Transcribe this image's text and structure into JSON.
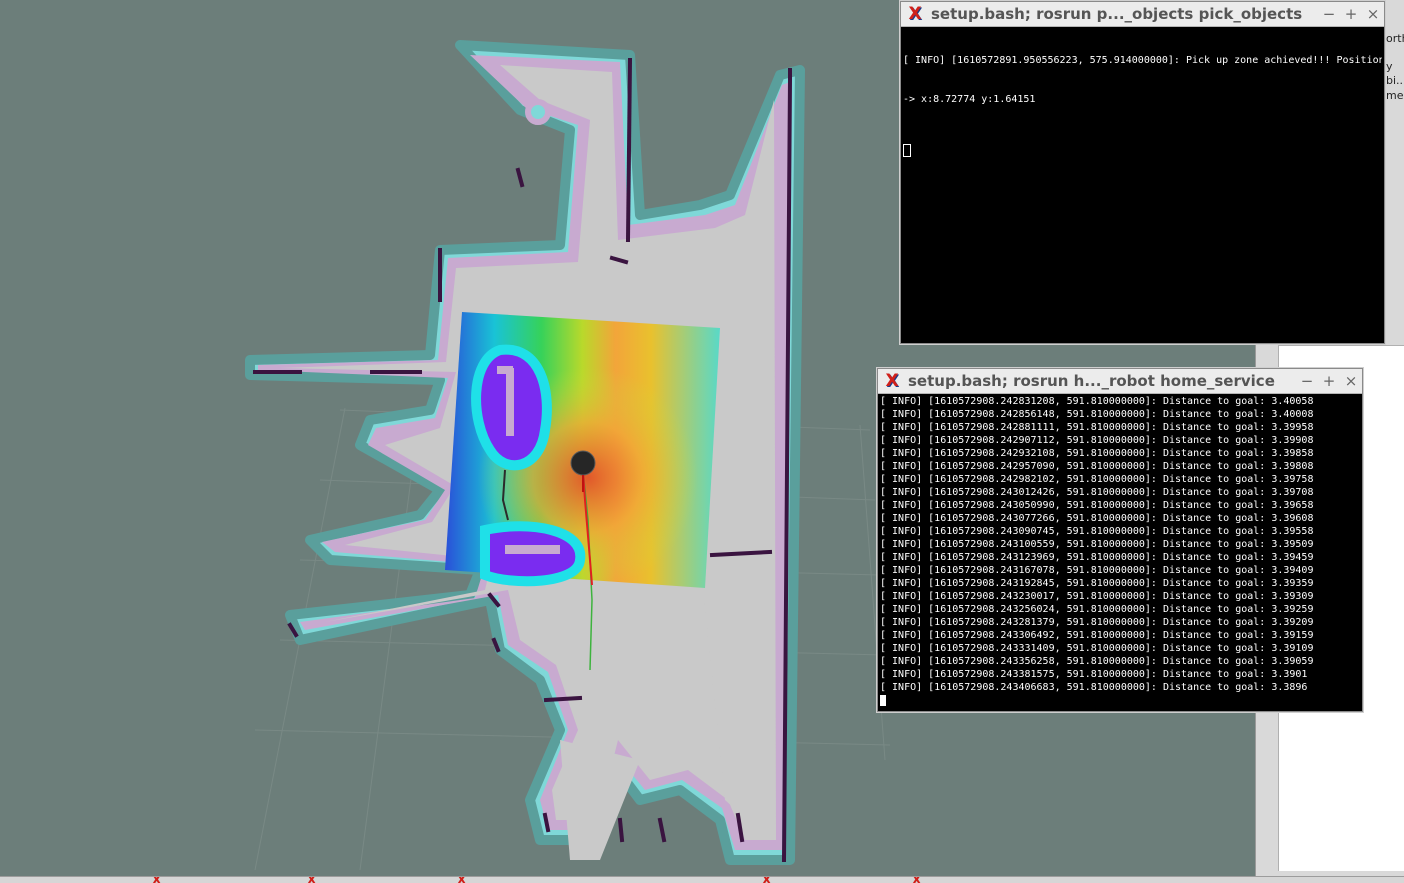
{
  "terminals": {
    "pick_objects": {
      "title": "setup.bash; rosrun p..._objects pick_objects",
      "lines": [
        "[ INFO] [1610572891.950556223, 575.914000000]: Pick up zone achieved!!! Position",
        "-> x:8.72774 y:1.64151"
      ]
    },
    "home_service": {
      "title": "setup.bash; rosrun h..._robot home_service",
      "lines": [
        "[ INFO] [1610572908.242831208, 591.810000000]: Distance to goal: 3.40058",
        "[ INFO] [1610572908.242856148, 591.810000000]: Distance to goal: 3.40008",
        "[ INFO] [1610572908.242881111, 591.810000000]: Distance to goal: 3.39958",
        "[ INFO] [1610572908.242907112, 591.810000000]: Distance to goal: 3.39908",
        "[ INFO] [1610572908.242932108, 591.810000000]: Distance to goal: 3.39858",
        "[ INFO] [1610572908.242957090, 591.810000000]: Distance to goal: 3.39808",
        "[ INFO] [1610572908.242982102, 591.810000000]: Distance to goal: 3.39758",
        "[ INFO] [1610572908.243012426, 591.810000000]: Distance to goal: 3.39708",
        "[ INFO] [1610572908.243050990, 591.810000000]: Distance to goal: 3.39658",
        "[ INFO] [1610572908.243077266, 591.810000000]: Distance to goal: 3.39608",
        "[ INFO] [1610572908.243090745, 591.810000000]: Distance to goal: 3.39558",
        "[ INFO] [1610572908.243100559, 591.810000000]: Distance to goal: 3.39509",
        "[ INFO] [1610572908.243123969, 591.810000000]: Distance to goal: 3.39459",
        "[ INFO] [1610572908.243167078, 591.810000000]: Distance to goal: 3.39409",
        "[ INFO] [1610572908.243192845, 591.810000000]: Distance to goal: 3.39359",
        "[ INFO] [1610572908.243230017, 591.810000000]: Distance to goal: 3.39309",
        "[ INFO] [1610572908.243256024, 591.810000000]: Distance to goal: 3.39259",
        "[ INFO] [1610572908.243281379, 591.810000000]: Distance to goal: 3.39209",
        "[ INFO] [1610572908.243306492, 591.810000000]: Distance to goal: 3.39159",
        "[ INFO] [1610572908.243331409, 591.810000000]: Distance to goal: 3.39109",
        "[ INFO] [1610572908.243356258, 591.810000000]: Distance to goal: 3.39059",
        "[ INFO] [1610572908.243381575, 591.810000000]: Distance to goal: 3.3901",
        "[ INFO] [1610572908.243406683, 591.810000000]: Distance to goal: 3.3896"
      ]
    }
  },
  "window_buttons": {
    "minimize": "−",
    "maximize": "+",
    "close": "×"
  },
  "right_panel": {
    "fragments": [
      "orth",
      "y",
      "bi...",
      "me"
    ]
  },
  "colors": {
    "map_background": "#6c7e7a",
    "free_space": "#c9c9c9",
    "inflation": "#c8aad0",
    "inflation_edge": "#7fd8d8",
    "obstacle": "#3a1440",
    "terminal_bg": "#000000",
    "terminal_fg": "#ffffff"
  },
  "icons": {
    "terminal_app_icon": "x-logo-icon"
  }
}
